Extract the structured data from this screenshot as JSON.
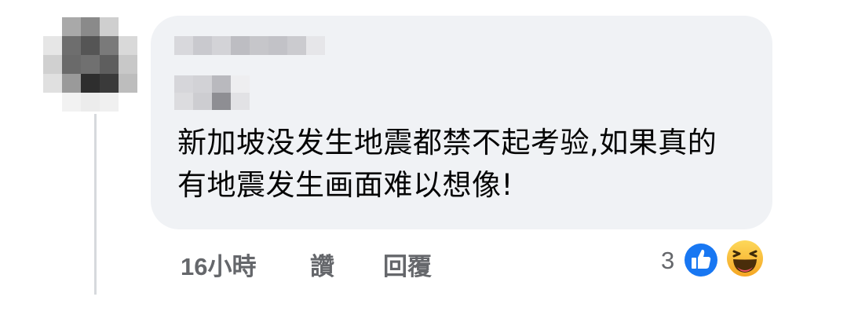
{
  "comment": {
    "text": "新加坡没发生地震都禁不起考验,如果真的有地震发生画面难以想像!"
  },
  "actions": {
    "timestamp": "16小時",
    "like_label": "讚",
    "reply_label": "回覆"
  },
  "reactions": {
    "count": "3",
    "icons": [
      "like-icon",
      "haha-icon"
    ],
    "like_color": "#1877f2",
    "haha_color": "#f7b125"
  },
  "colors": {
    "bubble": "#f0f2f5",
    "text": "#050505",
    "meta": "#65676b"
  }
}
